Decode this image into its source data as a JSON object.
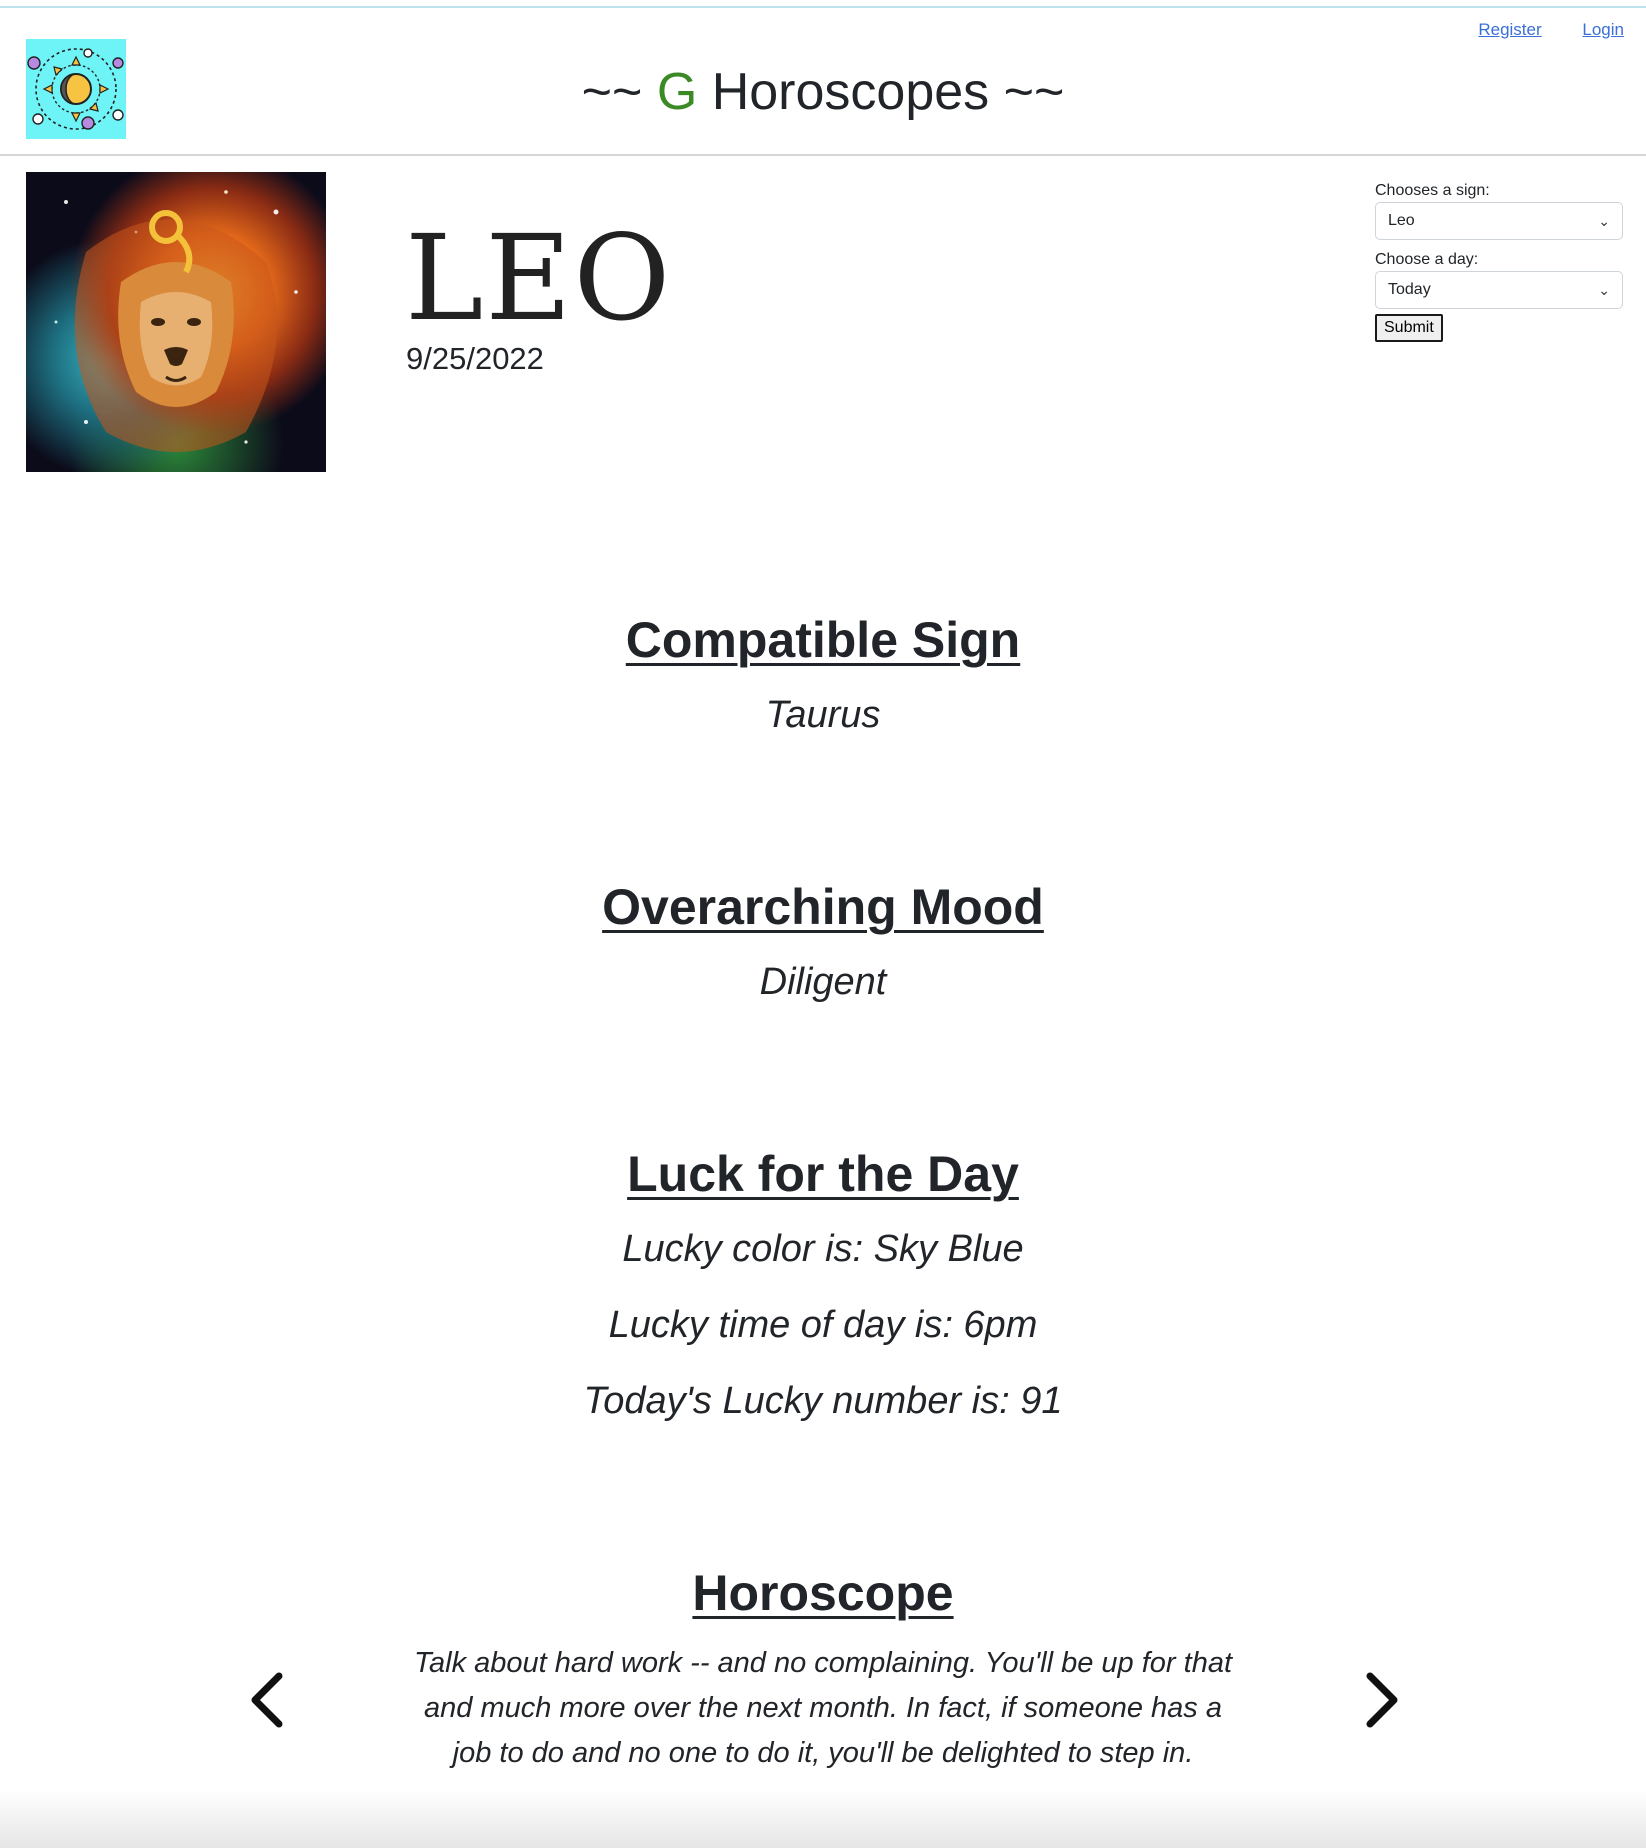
{
  "header": {
    "title_prefix": "~~ ",
    "title_accent": "G",
    "title_suffix": " Horoscopes ~~",
    "accent_color": "#3b8a26",
    "logo_icon": "sun-moon-planets-icon",
    "links": {
      "register": "Register",
      "login": "Login"
    }
  },
  "sign": {
    "name": "LEO",
    "date": "9/25/2022",
    "image_icon": "lion-artwork"
  },
  "form": {
    "sign_label": "Chooses a sign:",
    "sign_value": "Leo",
    "day_label": "Choose a day:",
    "day_value": "Today",
    "submit_label": "Submit"
  },
  "sections": {
    "compatible": {
      "heading": "Compatible Sign",
      "value": "Taurus"
    },
    "mood": {
      "heading": "Overarching Mood",
      "value": "Diligent"
    },
    "luck": {
      "heading": "Luck for the Day",
      "color_line": "Lucky color is: Sky Blue",
      "time_line": "Lucky time of day is: 6pm",
      "number_line": "Today's Lucky number is: 91"
    },
    "horoscope": {
      "heading": "Horoscope",
      "text": "Talk about hard work -- and no complaining. You'll be up for that and much more over the next month. In fact, if someone has a job to do and no one to do it, you'll be delighted to step in."
    }
  },
  "carousel": {
    "prev_icon": "chevron-left-icon",
    "next_icon": "chevron-right-icon"
  }
}
